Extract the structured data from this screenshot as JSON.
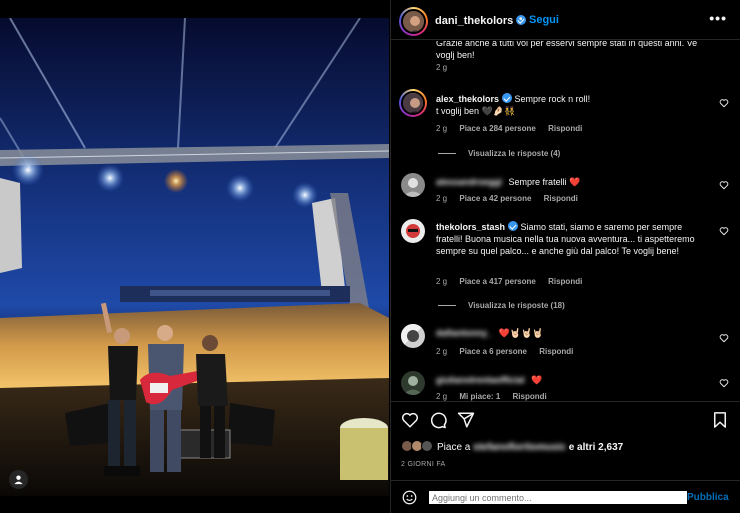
{
  "header": {
    "username": "dani_thekolors",
    "separator": "•",
    "follow_label": "Segui",
    "more_label": "•••"
  },
  "comments": [
    {
      "id": "partial",
      "text": "Grazie anche a tutti voi per esservi sempre stati in questi anni. Ve voglj ben!",
      "time": "2 g"
    },
    {
      "id": "alex",
      "username": "alex_thekolors",
      "text": "Sempre rock n roll!",
      "text2": "t voglij ben 🖤🤌🏻👯",
      "time": "2 g",
      "likes": "Piace a 284 persone",
      "reply": "Rispondi",
      "replies": "Visualizza le risposte (4)"
    },
    {
      "id": "alessandro",
      "username": "alessandroeggi",
      "text": "Sempre fratelli ❤️",
      "time": "2 g",
      "likes": "Piace a 42 persone",
      "reply": "Rispondi"
    },
    {
      "id": "stash",
      "username": "thekolors_stash",
      "text": "Siamo stati, siamo e saremo per sempre fratelli! Buona musica nella tua nuova avventura... ti aspetteremo sempre su quel palco... e anche giù dal palco! Te voglij bene!",
      "time": "2 g",
      "likes": "Piace a 417 persone",
      "reply": "Rispondi",
      "replies": "Visualizza le risposte (18)"
    },
    {
      "id": "dafiantonny",
      "username": "dafiantonny_",
      "text": "❤️🤘🏻🤘🏻🤘🏻",
      "time": "2 g",
      "likes": "Piace a 6 persone",
      "reply": "Rispondi"
    },
    {
      "id": "official",
      "username": "giulianotrentaofficial",
      "text": "❤️",
      "time": "2 g",
      "likes": "Mi piace: 1",
      "reply": "Rispondi"
    }
  ],
  "actions": {
    "icons": [
      "heart-icon",
      "comment-icon",
      "share-icon",
      "bookmark-icon"
    ]
  },
  "likes": {
    "prefix": "Piace a ",
    "user": "stefanofioritomusic",
    "suffix": " e altri 2,637"
  },
  "date": "2 GIORNI FA",
  "add_comment": {
    "placeholder": "Aggiungi un commento...",
    "post_label": "Pubblica"
  },
  "colors": {
    "accent": "#0095f6",
    "muted": "#a8a8a8",
    "background": "#000000",
    "verified": "#3897f0"
  }
}
